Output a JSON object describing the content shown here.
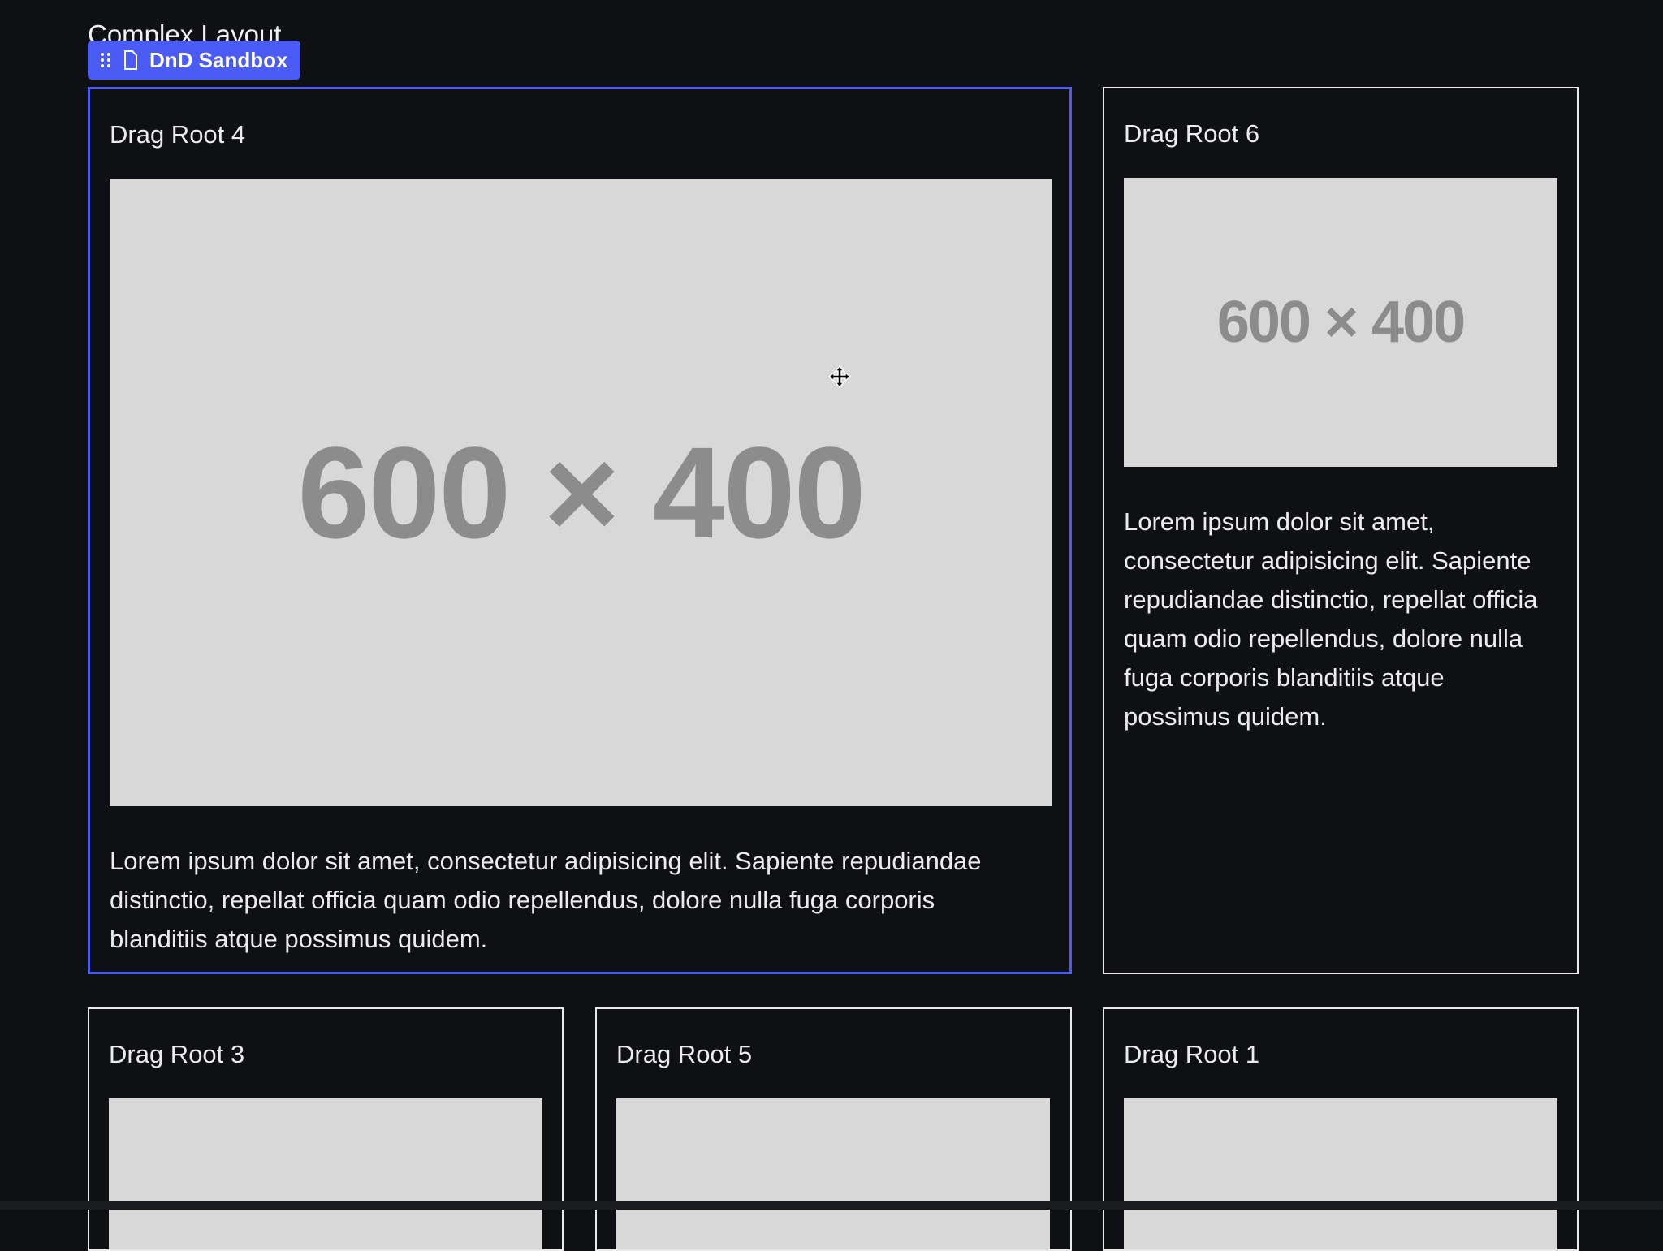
{
  "page": {
    "title": "Complex Layout"
  },
  "sandbox_tag": {
    "label": "DnD Sandbox",
    "grip_icon": "drag-handle-icon",
    "doc_icon": "document-icon",
    "color": "#4b5bf5"
  },
  "cards": [
    {
      "title": "Drag Root 4",
      "placeholder": "600 × 400",
      "text": "Lorem ipsum dolor sit amet, consectetur adipisicing elit. Sapiente repudiandae distinctio, repellat officia quam odio repellendus, dolore nulla fuga corporis blanditiis atque possimus quidem.",
      "selected": true
    },
    {
      "title": "Drag Root 6",
      "placeholder": "600 × 400",
      "text": "Lorem ipsum dolor sit amet, consectetur adipisicing elit. Sapiente repudiandae distinctio, repellat officia quam odio repellendus, dolore nulla fuga corporis blanditiis atque possimus quidem.",
      "selected": false
    },
    {
      "title": "Drag Root 3"
    },
    {
      "title": "Drag Root 5"
    },
    {
      "title": "Drag Root 1"
    }
  ],
  "colors": {
    "background": "#0e1013",
    "card_border": "#e9e9e9",
    "selection": "#4b5bf5",
    "placeholder_bg": "#d8d8d8",
    "placeholder_text": "#8c8c8c"
  },
  "cursor": {
    "icon": "move-cursor-icon"
  }
}
